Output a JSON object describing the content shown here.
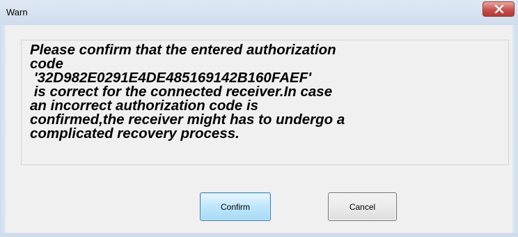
{
  "window": {
    "title": "Warn"
  },
  "message": {
    "text": "Please confirm that the entered authorization\ncode\n '32D982E0291E4DE485169142B160FAEF'\n is correct for the connected receiver.In case\nan incorrect authorization code is\nconfirmed,the receiver might has to undergo a\ncomplicated recovery process."
  },
  "buttons": {
    "confirm_label": "Confirm",
    "cancel_label": "Cancel"
  },
  "icons": {
    "close": "close-icon"
  },
  "colors": {
    "close_button": "#c75050",
    "confirm_border": "#3c7fb1",
    "window_bg": "#f0f0f0"
  }
}
